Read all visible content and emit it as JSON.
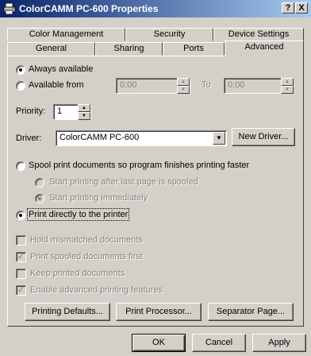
{
  "window": {
    "title": "ColorCAMM PC-600 Properties",
    "help_btn": "?",
    "close_btn": "X"
  },
  "tabs": {
    "row1": [
      "Color Management",
      "Security",
      "Device Settings"
    ],
    "row2": [
      "General",
      "Sharing",
      "Ports",
      "Advanced"
    ],
    "active": "Advanced"
  },
  "availability": {
    "always_label": "Always available",
    "from_label": "Available from",
    "from_value": "0:00",
    "to_label": "To",
    "to_value": "0:00",
    "selected": "always"
  },
  "priority": {
    "label": "Priority:",
    "value": "1"
  },
  "driver": {
    "label": "Driver:",
    "value": "ColorCAMM PC-600",
    "new_driver_button": "New Driver..."
  },
  "spool": {
    "spool_label": "Spool print documents so program finishes printing faster",
    "after_last_page_label": "Start printing after last page is spooled",
    "immediately_label": "Start printing immediately",
    "direct_label": "Print directly to the printer",
    "selected": "direct"
  },
  "options": [
    {
      "label": "Hold mismatched documents",
      "checked": false
    },
    {
      "label": "Print spooled documents first",
      "checked": true
    },
    {
      "label": "Keep printed documents",
      "checked": false
    },
    {
      "label": "Enable advanced printing features",
      "checked": true
    }
  ],
  "buttons": {
    "printing_defaults": "Printing Defaults...",
    "print_processor": "Print Processor...",
    "separator_page": "Separator Page...",
    "ok": "OK",
    "cancel": "Cancel",
    "apply": "Apply"
  }
}
